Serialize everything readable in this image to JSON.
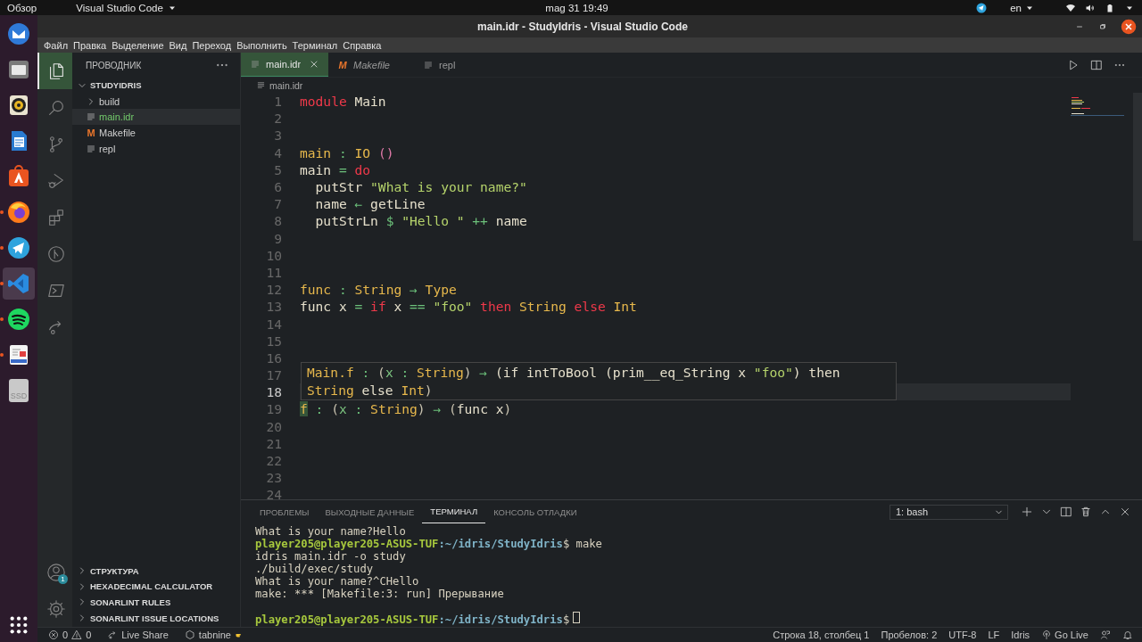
{
  "topbar": {
    "activities": "Обзор",
    "app": "Visual Studio Code",
    "clock": "mag 31  19:49",
    "language": "en"
  },
  "dock": [
    {
      "kind": "mail",
      "running": false,
      "selected": false
    },
    {
      "kind": "files",
      "running": false,
      "selected": false
    },
    {
      "kind": "music",
      "running": false,
      "selected": false
    },
    {
      "kind": "writer",
      "running": false,
      "selected": false
    },
    {
      "kind": "store",
      "running": false,
      "selected": false
    },
    {
      "kind": "browser",
      "running": true,
      "selected": false
    },
    {
      "kind": "messenger",
      "running": true,
      "selected": false
    },
    {
      "kind": "editor",
      "running": true,
      "selected": true
    },
    {
      "kind": "player",
      "running": true,
      "selected": false
    },
    {
      "kind": "document",
      "running": true,
      "selected": false
    },
    {
      "kind": "drive",
      "label": "SSD",
      "running": false,
      "selected": false
    }
  ],
  "window": {
    "title": "main.idr - StudyIdris - Visual Studio Code"
  },
  "menu": [
    "Файл",
    "Правка",
    "Выделение",
    "Вид",
    "Переход",
    "Выполнить",
    "Терминал",
    "Справка"
  ],
  "activity_bar": [
    {
      "kind": "explorer",
      "selected": true
    },
    {
      "kind": "search",
      "selected": false
    },
    {
      "kind": "source-control",
      "selected": false
    },
    {
      "kind": "debug",
      "selected": false
    },
    {
      "kind": "extensions",
      "selected": false
    },
    {
      "kind": "git-graph",
      "selected": false
    },
    {
      "kind": "terminal",
      "selected": false
    },
    {
      "kind": "live-share",
      "selected": false
    }
  ],
  "account_badge": "1",
  "sidebar": {
    "title": "ПРОВОДНИК",
    "folder": {
      "name": "STUDYIDRIS",
      "expanded": true,
      "children": [
        {
          "name": "build",
          "kind": "folder",
          "expanded": false,
          "selected": false
        },
        {
          "name": "main.idr",
          "kind": "file",
          "selected": true
        },
        {
          "name": "Makefile",
          "kind": "makefile",
          "icon": "M",
          "selected": false
        },
        {
          "name": "repl",
          "kind": "file",
          "selected": false
        }
      ]
    },
    "sections": [
      {
        "name": "СТРУКТУРА",
        "expanded": false
      },
      {
        "name": "HEXADECIMAL CALCULATOR",
        "expanded": false
      },
      {
        "name": "SONARLINT RULES",
        "expanded": false
      },
      {
        "name": "SONARLINT ISSUE LOCATIONS",
        "expanded": false
      }
    ]
  },
  "tabs": [
    {
      "label": "main.idr",
      "kind": "file",
      "selected": true,
      "preview": false
    },
    {
      "label": "Makefile",
      "kind": "makefile",
      "icon": "M",
      "selected": false,
      "preview": true
    },
    {
      "label": "repl",
      "kind": "file",
      "selected": false,
      "preview": false
    }
  ],
  "breadcrumb": "main.idr",
  "editor": {
    "lines": [
      {
        "n": "1",
        "current": false,
        "tokens": [
          {
            "text": "module",
            "kind": "kw"
          },
          {
            "text": " Main",
            "kind": "id"
          }
        ]
      },
      {
        "n": "2",
        "current": false
      },
      {
        "n": "3",
        "current": false
      },
      {
        "n": "4",
        "current": false,
        "tokens": [
          {
            "text": "main",
            "kind": "ty"
          },
          {
            "text": " : ",
            "kind": "op"
          },
          {
            "text": "IO ",
            "kind": "ty"
          },
          {
            "text": "()",
            "kind": "unit"
          }
        ]
      },
      {
        "n": "5",
        "current": false,
        "tokens": [
          {
            "text": "main",
            "kind": "id"
          },
          {
            "text": " = ",
            "kind": "op"
          },
          {
            "text": "do",
            "kind": "kw"
          }
        ]
      },
      {
        "n": "6",
        "current": false,
        "tokens": [
          {
            "text": "  putStr ",
            "kind": "id"
          },
          {
            "text": "\"What is your name?\"",
            "kind": "str"
          }
        ]
      },
      {
        "n": "7",
        "current": false,
        "tokens": [
          {
            "text": "  name ",
            "kind": "id"
          },
          {
            "text": "←",
            "kind": "op"
          },
          {
            "text": " getLine",
            "kind": "id"
          }
        ]
      },
      {
        "n": "8",
        "current": false,
        "tokens": [
          {
            "text": "  putStrLn ",
            "kind": "id"
          },
          {
            "text": "$ ",
            "kind": "op"
          },
          {
            "text": "\"Hello \"",
            "kind": "str"
          },
          {
            "text": " ++ ",
            "kind": "op"
          },
          {
            "text": "name",
            "kind": "id"
          }
        ]
      },
      {
        "n": "9",
        "current": false
      },
      {
        "n": "10",
        "current": false
      },
      {
        "n": "11",
        "current": false
      },
      {
        "n": "12",
        "current": false,
        "tokens": [
          {
            "text": "func",
            "kind": "ty"
          },
          {
            "text": " : ",
            "kind": "op"
          },
          {
            "text": "String",
            "kind": "ty"
          },
          {
            "text": " → ",
            "kind": "op"
          },
          {
            "text": "Type",
            "kind": "ty"
          }
        ]
      },
      {
        "n": "13",
        "current": false,
        "tokens": [
          {
            "text": "func x ",
            "kind": "id"
          },
          {
            "text": "= ",
            "kind": "op"
          },
          {
            "text": "if",
            "kind": "kw"
          },
          {
            "text": " x ",
            "kind": "id"
          },
          {
            "text": "== ",
            "kind": "op"
          },
          {
            "text": "\"foo\" ",
            "kind": "str"
          },
          {
            "text": "then ",
            "kind": "kw"
          },
          {
            "text": "String ",
            "kind": "ty"
          },
          {
            "text": "else ",
            "kind": "kw"
          },
          {
            "text": "Int",
            "kind": "ty"
          }
        ]
      },
      {
        "n": "14",
        "current": false
      },
      {
        "n": "15",
        "current": false
      },
      {
        "n": "16",
        "current": false
      },
      {
        "n": "17",
        "current": false
      },
      {
        "n": "18",
        "current": true
      },
      {
        "n": "19",
        "current": false,
        "tokens": [
          {
            "text": "f",
            "kind": "sel"
          },
          {
            "text": " : ",
            "kind": "op"
          },
          {
            "text": "(",
            "kind": "punct"
          },
          {
            "text": "x",
            "kind": "var"
          },
          {
            "text": " : ",
            "kind": "op"
          },
          {
            "text": "String",
            "kind": "ty"
          },
          {
            "text": ")",
            "kind": "punct"
          },
          {
            "text": " → ",
            "kind": "op"
          },
          {
            "text": "(",
            "kind": "punct"
          },
          {
            "text": "func x",
            "kind": "id"
          },
          {
            "text": ")",
            "kind": "punct"
          }
        ]
      },
      {
        "n": "20",
        "current": false
      },
      {
        "n": "21",
        "current": false
      },
      {
        "n": "22",
        "current": false
      },
      {
        "n": "23",
        "current": false
      },
      {
        "n": "24",
        "current": false
      }
    ],
    "hover": {
      "tokens": [
        {
          "text": "Main.f",
          "kind": "ty"
        },
        {
          "text": " : ",
          "kind": "op"
        },
        {
          "text": "(",
          "kind": "punct"
        },
        {
          "text": "x",
          "kind": "var"
        },
        {
          "text": " : ",
          "kind": "op"
        },
        {
          "text": "String",
          "kind": "ty"
        },
        {
          "text": ")",
          "kind": "punct"
        },
        {
          "text": " → ",
          "kind": "op"
        },
        {
          "text": "(if intToBool (prim__eq_String x ",
          "kind": "id"
        },
        {
          "text": "\"foo\"",
          "kind": "str"
        },
        {
          "text": ") then ",
          "kind": "id"
        },
        {
          "text": "String",
          "kind": "ty"
        },
        {
          "text": " else ",
          "kind": "id"
        },
        {
          "text": "Int",
          "kind": "ty"
        },
        {
          "text": ")",
          "kind": "punct"
        }
      ]
    }
  },
  "panel": {
    "tabs": [
      {
        "label": "ПРОБЛЕМЫ",
        "selected": false
      },
      {
        "label": "ВЫХОДНЫЕ ДАННЫЕ",
        "selected": false
      },
      {
        "label": "ТЕРМИНАЛ",
        "selected": true
      },
      {
        "label": "КОНСОЛЬ ОТЛАДКИ",
        "selected": false
      }
    ],
    "terminal_select": "1: bash",
    "terminal": [
      {
        "kind": "plain",
        "text": "What is your name?Hello"
      },
      {
        "kind": "prompt",
        "user": "player205@player205-ASUS-TUF",
        "path": ":~/idris/StudyIdris",
        "command": "$ make",
        "cursor": false
      },
      {
        "kind": "plain",
        "text": "idris main.idr -o study"
      },
      {
        "kind": "plain",
        "text": "./build/exec/study"
      },
      {
        "kind": "plain",
        "text": "What is your name?^CHello"
      },
      {
        "kind": "plain",
        "text": "make: *** [Makefile:3: run] Прерывание"
      },
      {
        "kind": "blank"
      },
      {
        "kind": "prompt",
        "user": "player205@player205-ASUS-TUF",
        "path": ":~/idris/StudyIdris",
        "command": "$",
        "cursor": true
      }
    ]
  },
  "status_bar": {
    "errors": "0",
    "warnings": "0",
    "live_share": "Live Share",
    "tabnine": "tabnine",
    "position": "Строка 18, столбец 1",
    "indent": "Пробелов: 2",
    "encoding": "UTF-8",
    "eol": "LF",
    "language": "Idris",
    "go_live": "Go Live"
  }
}
